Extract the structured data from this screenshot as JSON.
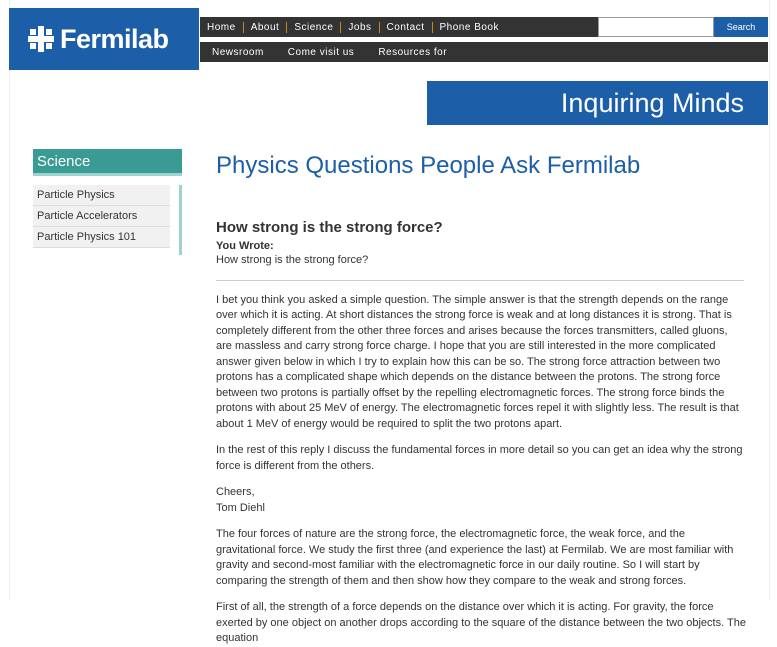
{
  "logo": {
    "text": "Fermilab"
  },
  "nav": {
    "primary": [
      "Home",
      "About",
      "Science",
      "Jobs",
      "Contact",
      "Phone Book"
    ],
    "secondary": [
      "Newsroom",
      "Come visit us",
      "Resources for"
    ]
  },
  "search": {
    "value": "",
    "placeholder": "",
    "button_label": "Search"
  },
  "banner": {
    "title": "Inquiring Minds"
  },
  "sidebar": {
    "header": "Science",
    "items": [
      {
        "label": "Particle Physics"
      },
      {
        "label": "Particle Accelerators"
      },
      {
        "label": "Particle Physics 101"
      }
    ]
  },
  "main": {
    "page_title": "Physics Questions People Ask Fermilab",
    "question_title": "How strong is the strong force?",
    "you_wrote_label": "You Wrote:",
    "question_text": "How strong is the strong force?",
    "paragraphs": [
      "I bet you think you asked a simple question. The simple answer is that the strength depends on the range over which it is acting. At short distances the strong force is weak and at long distances it is strong. That is completely different from the other three forces and arises because the forces transmitters, called gluons, are massless and carry strong force charge. I hope that you are still interested in the more complicated answer given below in which I try to explain how this can be so. The strong force attraction between two protons has a complicated shape which depends on the distance between the protons. The strong force between two protons is partially offset by the repelling electromagnetic forces. The strong force binds the protons with about 25 MeV of energy. The electromagnetic forces repel it with slightly less. The result is that about 1 MeV of energy would be required to split the two protons apart.",
      "In the rest of this reply I discuss the fundamental forces in more detail so you can get an idea why the strong force is different from the others.",
      "Cheers,",
      "Tom Diehl",
      "The four forces of nature are the strong force, the electromagnetic force, the weak force, and the gravitational force. We study the first three (and experience the last) at Fermilab. We are most familiar with gravity and second-most familiar with the electromagnetic force in our daily routine. So I will start by comparing the strength of them and then show how they compare to the weak and strong forces.",
      "First of all, the strength of a force depends on the distance over which it is acting. For gravity, the force exerted by one object on another drops according to the square of the distance between the two objects. The equation"
    ]
  },
  "colors": {
    "brand_blue": "#1d5ea8",
    "nav_dark": "#333333",
    "sidebar_teal": "#3a9a94",
    "nav_separator": "#c08a1a"
  }
}
